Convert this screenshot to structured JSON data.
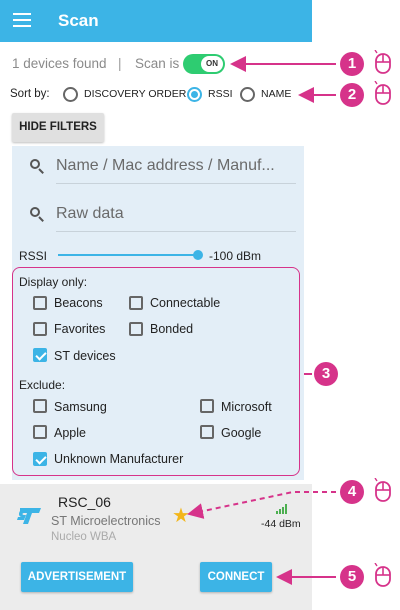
{
  "appbar": {
    "title": "Scan",
    "color": "#3cb4e6"
  },
  "status": {
    "devices_found": "1 devices found",
    "separator": "|",
    "scan_label": "Scan is",
    "toggle_text": "ON"
  },
  "sort": {
    "label": "Sort by:",
    "options": [
      {
        "label": "DISCOVERY ORDER",
        "selected": false
      },
      {
        "label": "RSSI",
        "selected": true
      },
      {
        "label": "NAME",
        "selected": false
      }
    ]
  },
  "filters": {
    "toggle_button": "HIDE FILTERS",
    "name_placeholder": "Name / Mac address / Manuf...",
    "raw_placeholder": "Raw data",
    "rssi_label": "RSSI",
    "rssi_value": "-100 dBm",
    "display_only_title": "Display only:",
    "display_only": [
      {
        "label": "Beacons",
        "checked": false
      },
      {
        "label": "Connectable",
        "checked": false
      },
      {
        "label": "Favorites",
        "checked": false
      },
      {
        "label": "Bonded",
        "checked": false
      },
      {
        "label": "ST devices",
        "checked": true
      }
    ],
    "exclude_title": "Exclude:",
    "exclude": [
      {
        "label": "Samsung",
        "checked": false
      },
      {
        "label": "Microsoft",
        "checked": false
      },
      {
        "label": "Apple",
        "checked": false
      },
      {
        "label": "Google",
        "checked": false
      },
      {
        "label": "Unknown Manufacturer",
        "checked": true
      }
    ]
  },
  "device": {
    "name": "RSC_06",
    "manufacturer": "ST Microelectronics",
    "model": "Nucleo WBA",
    "rssi": "-44 dBm",
    "favorite": true,
    "advertisement_button": "ADVERTISEMENT",
    "connect_button": "CONNECT"
  },
  "annotations": {
    "color": "#d6338a",
    "badges": [
      "1",
      "2",
      "3",
      "4",
      "5"
    ]
  }
}
